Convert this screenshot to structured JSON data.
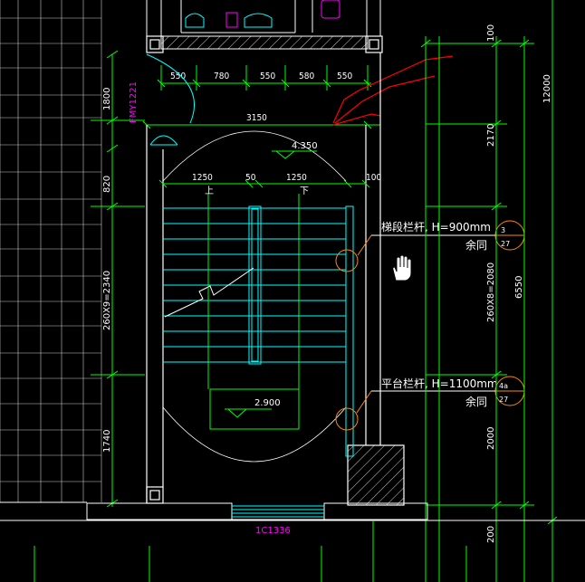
{
  "drawing": {
    "top_dims": [
      "550",
      "780",
      "550",
      "580",
      "550"
    ],
    "overall_width": "3150",
    "stair_widths": [
      "1250",
      "50",
      "1250",
      "100"
    ],
    "door_label": "FMY1221",
    "window_label": "1C1336",
    "levels": {
      "upper": "4.350",
      "lower": "2.900"
    },
    "walk": {
      "up": "上",
      "down": "下"
    },
    "left_dims": [
      "1800",
      "820",
      "260X9=2340",
      "1740"
    ],
    "right_dims": {
      "col1": [
        "100",
        "2170",
        "260X8=2080",
        "2000",
        "200"
      ],
      "col2": [
        "6550"
      ],
      "col3": [
        "12000"
      ]
    },
    "callouts": [
      {
        "text": "梯段栏杆, H=900mm",
        "sub": "余同",
        "ref_top": "3",
        "ref_bottom": "27"
      },
      {
        "text": "平台栏杆, H=1100mm",
        "sub": "余同",
        "ref_top": "4a",
        "ref_bottom": "27"
      }
    ],
    "colors": {
      "background": "#000000",
      "wall": "#ffffff",
      "grid": "#00ff00",
      "stair": "#00ffff",
      "callout": "#ff8800",
      "markup": "#ff0000",
      "label": "#ff00ff"
    },
    "cursor_icon": "hand-cursor-icon"
  }
}
